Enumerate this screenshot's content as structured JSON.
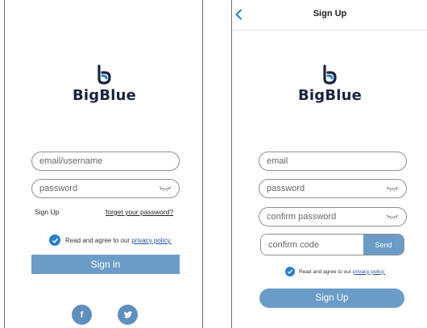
{
  "login": {
    "logo_text": "BigBlue",
    "email_placeholder": "email/username",
    "password_placeholder": "password",
    "signup_link": "Sign Up",
    "forget_link": "forget your password?",
    "agree_text": "Read and agree to our",
    "privacy_link": "privacy policy.",
    "signin_button": "Sign in",
    "social": {
      "facebook_label": "f",
      "twitter_icon": "twitter-bird-icon"
    }
  },
  "signup": {
    "header_title": "Sign Up",
    "logo_text": "BigBlue",
    "email_placeholder": "email",
    "password_placeholder": "password",
    "confirm_password_placeholder": "confirm password",
    "confirm_code_placeholder": "confirm code",
    "send_button": "Send",
    "agree_text": "Read and agree to our",
    "privacy_link": "privacy policy.",
    "signup_button": "Sign Up"
  },
  "colors": {
    "accent": "#6a9cc7",
    "check": "#2a7fc8",
    "logo_dark": "#1a2440",
    "social": "#5f8fbd"
  }
}
